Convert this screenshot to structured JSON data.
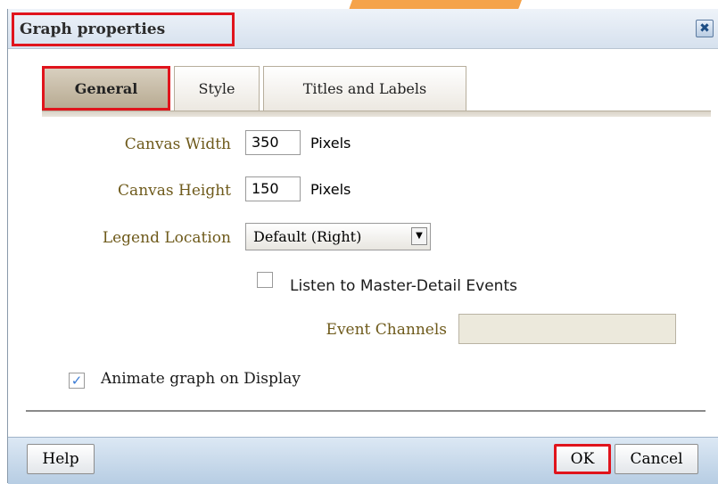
{
  "dialog": {
    "title": "Graph properties",
    "close_icon": "✖"
  },
  "tabs": [
    {
      "label": "General",
      "active": true
    },
    {
      "label": "Style",
      "active": false
    },
    {
      "label": "Titles and Labels",
      "active": false
    }
  ],
  "form": {
    "canvas_width_label": "Canvas Width",
    "canvas_width_value": "350",
    "canvas_width_unit": "Pixels",
    "canvas_height_label": "Canvas Height",
    "canvas_height_value": "150",
    "canvas_height_unit": "Pixels",
    "legend_location_label": "Legend Location",
    "legend_location_value": "Default (Right)",
    "listen_label": "Listen to Master-Detail Events",
    "listen_checked": false,
    "event_channels_label": "Event Channels",
    "event_channels_value": "",
    "animate_label": "Animate graph on Display",
    "animate_checked": true
  },
  "footer": {
    "help_label": "Help",
    "ok_label": "OK",
    "cancel_label": "Cancel"
  },
  "colors": {
    "highlight": "#e0141c",
    "label_text": "#6e5a1b",
    "titlebar": "#d6e1ee"
  }
}
